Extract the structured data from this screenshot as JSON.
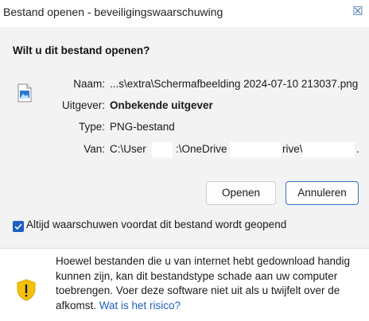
{
  "window": {
    "title": "Bestand openen - beveiligingswaarschuwing",
    "close_glyph": "☒"
  },
  "dialog": {
    "heading": "Wilt u dit bestand openen?",
    "file_icon": "image-file-icon",
    "fields": {
      "name_label": "Naam:",
      "name_value": "...s\\extra\\Schermafbeelding 2024-07-10 213037.png",
      "publisher_label": "Uitgever:",
      "publisher_value": "Onbekende uitgever",
      "type_label": "Type:",
      "type_value": "PNG-bestand",
      "from_label": "Van:",
      "from_value_part1": "C:\\User",
      "from_value_part2": ":\\OneDrive",
      "from_value_part3": "rive\\",
      "from_value_part4": "."
    },
    "buttons": {
      "open": "Openen",
      "cancel": "Annuleren"
    },
    "always_warn": {
      "label": "Altijd waarschuwen voordat dit bestand wordt geopend",
      "checked": true
    },
    "warning": {
      "icon": "shield-warning-icon",
      "text": "Hoewel bestanden die u van internet hebt gedownload handig kunnen zijn, kan dit bestandstype schade aan uw computer toebrengen. Voer deze software niet uit als u twijfelt over de afkomst. ",
      "link": "Wat is het risico?"
    }
  },
  "colors": {
    "accent": "#1f5fbf",
    "content_bg": "#f3f3f3",
    "shield_yellow": "#f4c20d"
  }
}
